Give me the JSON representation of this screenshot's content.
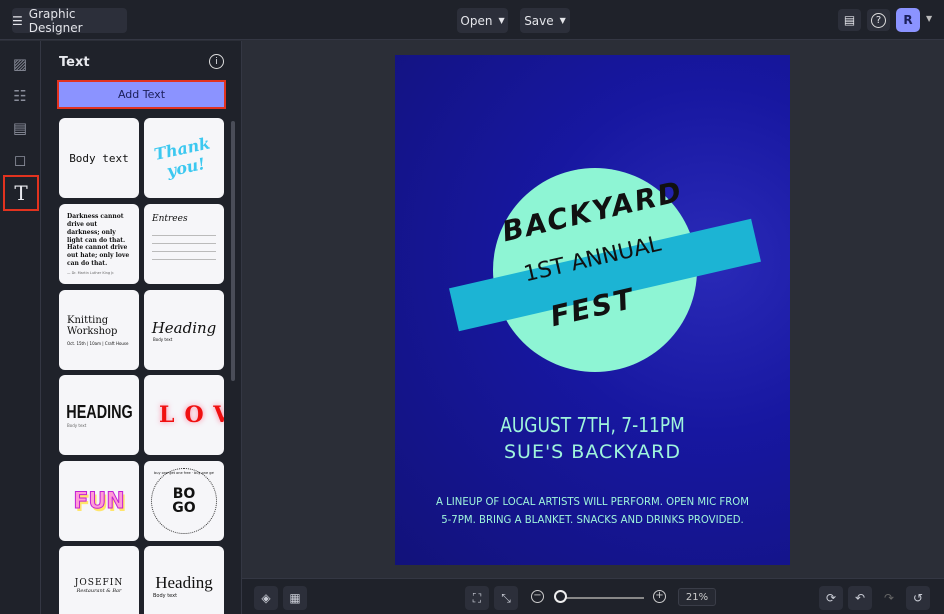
{
  "header": {
    "app_title": "Graphic Designer",
    "open_label": "Open",
    "save_label": "Save",
    "avatar_initial": "R"
  },
  "rail": [
    "image-icon",
    "sliders-icon",
    "layout-icon",
    "shapes-icon",
    "text-icon"
  ],
  "panel": {
    "title": "Text",
    "add_text_label": "Add Text",
    "cards": {
      "body": "Body text",
      "thanks": "Thank you!",
      "quote": "Darkness cannot drive out darkness; only light can do that. Hate cannot drive out hate; only love can do that.",
      "quote_author": "— Dr. Martin Luther King Jr.",
      "entrees": "Entrees",
      "knitting": "Knitting Workshop",
      "knitting_sub": "Oct. 15th | 10am | Craft House",
      "heading_script": "Heading",
      "body_small": "Body text",
      "heading_bold": "HEADING",
      "love": "LOVE",
      "fun": "FUN",
      "bogo": "BO GO",
      "bogo_ring": "buy one get one free · buy one get one free ·",
      "josefin": "JOSEFIN",
      "josefin_sub": "Restaurant & Bar",
      "heading_serif": "Heading"
    }
  },
  "poster": {
    "line1": "BACKYARD",
    "line2": "1ST ANNUAL",
    "line3": "FEST",
    "date": "AUGUST 7TH, 7-11PM",
    "place": "SUE'S BACKYARD",
    "desc1": "A LINEUP OF LOCAL ARTISTS WILL PERFORM. OPEN MIC FROM",
    "desc2": "5-7PM. BRING A BLANKET. SNACKS AND DRINKS PROVIDED.",
    "colors": {
      "bg": "#1717a0",
      "circle": "#8ef5d4",
      "ribbon": "#1cb4d4",
      "text": "#9ff5dc"
    }
  },
  "bottom": {
    "zoom": "21%",
    "zoom_fraction": 0.05
  }
}
